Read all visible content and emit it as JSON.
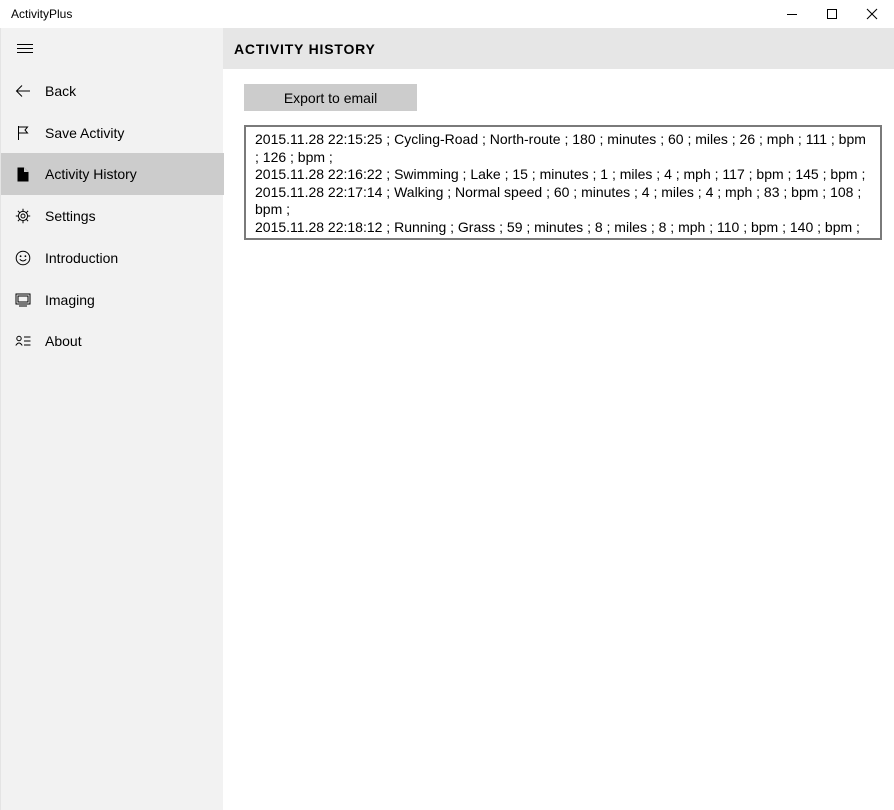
{
  "window": {
    "title": "ActivityPlus"
  },
  "sidebar": {
    "items": [
      {
        "label": "Back",
        "icon": "back-arrow-icon"
      },
      {
        "label": "Save Activity",
        "icon": "flag-icon"
      },
      {
        "label": "Activity History",
        "icon": "document-icon",
        "selected": true
      },
      {
        "label": "Settings",
        "icon": "gear-icon"
      },
      {
        "label": "Introduction",
        "icon": "smiley-icon"
      },
      {
        "label": "Imaging",
        "icon": "monitor-icon"
      },
      {
        "label": "About",
        "icon": "contact-list-icon"
      }
    ]
  },
  "header": {
    "title": "ACTIVITY HISTORY"
  },
  "main": {
    "export_label": "Export to email",
    "history": [
      "2015.11.28 22:15:25 ; Cycling-Road ; North-route ; 180 ; minutes ; 60 ; miles ; 26 ; mph ; 111 ; bpm ; 126 ; bpm ;",
      "2015.11.28 22:16:22 ; Swimming ; Lake ; 15 ; minutes ; 1 ; miles ; 4 ; mph ; 117 ; bpm ; 145 ; bpm ;",
      "2015.11.28 22:17:14 ; Walking ; Normal speed ; 60 ; minutes ; 4 ; miles ; 4 ; mph ; 83 ; bpm ; 108 ; bpm ;",
      "2015.11.28 22:18:12 ; Running ; Grass ; 59 ; minutes ; 8 ; miles ; 8 ; mph ; 110 ; bpm ; 140 ; bpm ;"
    ]
  },
  "colors": {
    "sidebar_bg": "#f2f2f2",
    "selected_bg": "#cccccc",
    "header_bg": "#e6e6e6",
    "button_bg": "#cccccc"
  }
}
